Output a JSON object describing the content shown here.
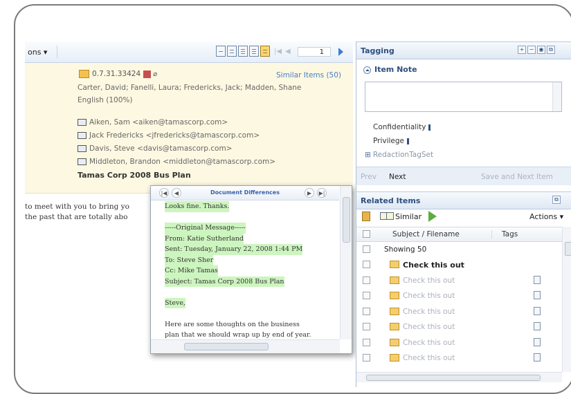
{
  "toolbar": {
    "options_label": "ons ▾",
    "page_number": "1"
  },
  "document": {
    "doc_id": "0.7.31.33424",
    "similar_items": "Similar Items (50)",
    "custodians": "Carter, David; Fanelli, Laura; Fredericks, Jack; Madden, Shane",
    "language": "English (100%)",
    "recipients": [
      "Aiken, Sam <aiken@tamascorp.com>",
      "Jack Fredericks <jfredericks@tamascorp.com>",
      "Davis, Steve  <davis@tamascorp.com>",
      "Middleton, Brandon <middleton@tamascorp.com>"
    ],
    "subject": "Tamas Corp 2008 Bus Plan",
    "body_lines": [
      "to meet with you to bring yo",
      "the past that are totally abo"
    ]
  },
  "popup": {
    "title": "Document Differences",
    "lines": [
      {
        "text": "Looks fine. Thanks.",
        "hl": true
      },
      {
        "text": "",
        "hl": false
      },
      {
        "text": "-----Original Message-----",
        "hl": true
      },
      {
        "text": "From: Katie Sutherland",
        "hl": true
      },
      {
        "text": "Sent: Tuesday, January 22, 2008 1:44 PM",
        "hl": true
      },
      {
        "text": "To: Steve Sher",
        "hl": true
      },
      {
        "text": "Cc: Mike Tamas",
        "hl": true
      },
      {
        "text": "Subject: Tamas Corp 2008 Bus Plan",
        "hl": true
      },
      {
        "text": "",
        "hl": false
      },
      {
        "text": "Steve,",
        "hl": true
      },
      {
        "text": "",
        "hl": false
      },
      {
        "text": "Here are some thoughts on the business",
        "hl": false
      },
      {
        "text": "plan that we should wrap up by end of year.",
        "hl": false
      }
    ]
  },
  "tagging": {
    "title": "Tagging",
    "item_note": "Item Note",
    "tags": [
      "Confidentiality",
      "Privilege"
    ],
    "tagset": "RedactionTagSet",
    "prev": "Prev",
    "next": "Next",
    "save_next": "Save and Next Item"
  },
  "related": {
    "title": "Related Items",
    "similar_label": "Similar",
    "actions_label": "Actions ▾",
    "col_subject": "Subject / Filename",
    "col_tags": "Tags",
    "showing": "Showing 50",
    "rows": [
      {
        "subject": "Check this out",
        "bold": true
      },
      {
        "subject": "Check this out",
        "bold": false
      },
      {
        "subject": "Check this out",
        "bold": false
      },
      {
        "subject": "Check this out",
        "bold": false
      },
      {
        "subject": "Check this out",
        "bold": false
      },
      {
        "subject": "Check this out",
        "bold": false
      },
      {
        "subject": "Check this out",
        "bold": false
      }
    ]
  }
}
